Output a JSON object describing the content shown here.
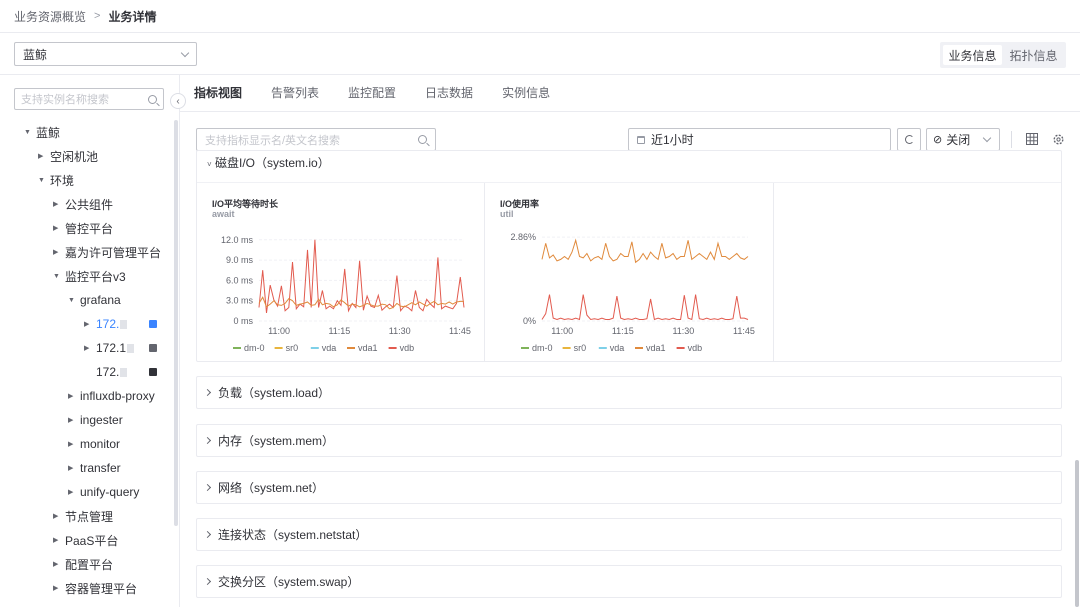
{
  "breadcrumb": {
    "parent": "业务资源概览",
    "separator": ">",
    "current": "业务详情"
  },
  "business_select": {
    "value": "蓝鲸"
  },
  "view_toggle": {
    "options": [
      "业务信息",
      "拓扑信息"
    ],
    "active": 0
  },
  "tree_search": {
    "placeholder": "支持实例名称搜索"
  },
  "tree": [
    {
      "label": "蓝鲸",
      "depth": 0,
      "expanded": true
    },
    {
      "label": "空闲机池",
      "depth": 1,
      "expanded": false
    },
    {
      "label": "环境",
      "depth": 1,
      "expanded": true
    },
    {
      "label": "公共组件",
      "depth": 2,
      "expanded": false
    },
    {
      "label": "管控平台",
      "depth": 2,
      "expanded": false
    },
    {
      "label": "嘉为许可管理平台",
      "depth": 2,
      "expanded": false
    },
    {
      "label": "监控平台v3",
      "depth": 2,
      "expanded": true
    },
    {
      "label": "grafana",
      "depth": 3,
      "expanded": true
    },
    {
      "label": "172.",
      "depth": 4,
      "expanded": false,
      "selected": true,
      "status_color": "#3a84ff"
    },
    {
      "label": "172.1",
      "depth": 4,
      "expanded": false,
      "status_color": "#63656e"
    },
    {
      "label": "172.",
      "depth": 4,
      "leaf": true,
      "status_color": "#313238"
    },
    {
      "label": "influxdb-proxy",
      "depth": 3,
      "expanded": false
    },
    {
      "label": "ingester",
      "depth": 3,
      "expanded": false
    },
    {
      "label": "monitor",
      "depth": 3,
      "expanded": false
    },
    {
      "label": "transfer",
      "depth": 3,
      "expanded": false
    },
    {
      "label": "unify-query",
      "depth": 3,
      "expanded": false
    },
    {
      "label": "节点管理",
      "depth": 2,
      "expanded": false
    },
    {
      "label": "PaaS平台",
      "depth": 2,
      "expanded": false
    },
    {
      "label": "配置平台",
      "depth": 2,
      "expanded": false
    },
    {
      "label": "容器管理平台",
      "depth": 2,
      "expanded": false
    }
  ],
  "tabs": [
    "指标视图",
    "告警列表",
    "监控配置",
    "日志数据",
    "实例信息"
  ],
  "active_tab": 0,
  "metric_search": {
    "placeholder": "支持指标显示名/英文名搜索"
  },
  "time_range": {
    "value": "近1小时"
  },
  "auto_refresh": {
    "value": "关闭"
  },
  "io_section": {
    "title": "磁盘I/O（system.io）"
  },
  "sections": [
    {
      "title": "负载（system.load）"
    },
    {
      "title": "内存（system.mem）"
    },
    {
      "title": "网络（system.net）"
    },
    {
      "title": "连接状态（system.netstat）"
    },
    {
      "title": "交换分区（system.swap）"
    }
  ],
  "colors": {
    "accent": "#3a84ff",
    "dm-0": "#7fb35a",
    "sr0": "#e8b53d",
    "vda": "#7ed0e8",
    "vda1": "#e08a3c",
    "vdb": "#e25b4f"
  },
  "chart_data": [
    {
      "type": "line",
      "title": "I/O平均等待时长",
      "subtitle": "await",
      "x_ticks": [
        "11:00",
        "11:15",
        "11:30",
        "11:45"
      ],
      "y_ticks": [
        "0 ms",
        "3.0 ms",
        "6.0 ms",
        "9.0 ms",
        "12.0 ms"
      ],
      "ylim": [
        0,
        13
      ],
      "x_minutes": [
        55,
        106
      ],
      "legend": [
        "dm-0",
        "sr0",
        "vda",
        "vda1",
        "vdb"
      ],
      "series": [
        {
          "name": "vdb",
          "values": [
            2.0,
            7.5,
            1.2,
            5.3,
            3.1,
            2.2,
            5.2,
            1.5,
            2.0,
            8.7,
            1.8,
            2.5,
            2.1,
            10.5,
            2.0,
            12.0,
            2.0,
            4.5,
            1.8,
            2.2,
            1.8,
            3.0,
            2.3,
            7.7,
            1.5,
            2.6,
            2.0,
            8.9,
            1.6,
            3.7,
            2.2,
            2.0,
            3.8,
            1.6,
            2.1,
            2.5,
            2.0,
            6.7,
            1.5,
            2.2,
            2.0,
            1.5,
            4.5,
            2.0,
            1.5,
            3.2,
            2.5,
            2.0,
            9.4,
            1.8,
            2.2,
            2.0,
            1.8,
            2.6,
            6.5,
            2.0
          ]
        },
        {
          "name": "vda1",
          "values": [
            2.6,
            3.5,
            2.1,
            2.5,
            3.0,
            2.4,
            2.3,
            2.6,
            3.3,
            3.0,
            2.3,
            2.5,
            2.6,
            2.8,
            2.3,
            2.4,
            3.2,
            2.4,
            2.6,
            2.5,
            2.1,
            2.4,
            3.1,
            2.7,
            2.2,
            2.5,
            2.4,
            2.1,
            2.3,
            2.6,
            2.4,
            2.2,
            2.2,
            2.5,
            2.4,
            1.8,
            2.0,
            2.6,
            2.2,
            2.1,
            2.4,
            2.7,
            2.4,
            2.8,
            2.5,
            2.2,
            2.6,
            2.9,
            2.4,
            2.6,
            2.5,
            2.8,
            2.5,
            2.8,
            2.9,
            2.9
          ]
        }
      ]
    },
    {
      "type": "line",
      "title": "I/O使用率",
      "subtitle": "util",
      "x_ticks": [
        "11:00",
        "11:15",
        "11:30",
        "11:45"
      ],
      "y_ticks": [
        "0%",
        "2.86%"
      ],
      "ylim": [
        0,
        3.0
      ],
      "x_minutes": [
        55,
        106
      ],
      "legend": [
        "dm-0",
        "sr0",
        "vda",
        "vda1",
        "vdb"
      ],
      "series": [
        {
          "name": "vda1 (upper)",
          "values": [
            2.1,
            2.65,
            2.15,
            2.25,
            2.05,
            2.1,
            2.2,
            2.1,
            2.35,
            2.75,
            2.2,
            2.15,
            2.3,
            2.05,
            2.15,
            2.2,
            2.1,
            2.65,
            2.2,
            2.05,
            2.1,
            2.3,
            2.2,
            2.2,
            2.7,
            2.0,
            2.1,
            2.3,
            2.1,
            2.35,
            2.2,
            2.1,
            2.65,
            2.15,
            2.2,
            2.3,
            2.1,
            2.2,
            2.2,
            2.75,
            2.1,
            2.2,
            2.3,
            2.2,
            2.1,
            2.35,
            2.1,
            2.65,
            2.2,
            2.2,
            2.1,
            2.2,
            2.3,
            2.15,
            2.1,
            2.2
          ]
        },
        {
          "name": "vdb (lower)",
          "values": [
            0.05,
            0.25,
            0.9,
            0.1,
            0.05,
            0.1,
            0.05,
            0.08,
            0.05,
            0.1,
            0.05,
            0.9,
            0.2,
            0.05,
            0.08,
            0.05,
            0.1,
            0.05,
            0.05,
            0.1,
            0.85,
            0.1,
            0.05,
            0.08,
            0.05,
            0.1,
            0.05,
            0.05,
            0.08,
            0.75,
            0.05,
            0.1,
            0.05,
            0.08,
            0.05,
            0.1,
            0.05,
            0.05,
            0.88,
            0.1,
            0.05,
            0.9,
            0.08,
            0.05,
            0.1,
            0.05,
            0.08,
            0.05,
            0.1,
            0.05,
            0.05,
            0.08,
            0.85,
            0.1,
            0.1,
            0.05
          ]
        }
      ]
    }
  ]
}
